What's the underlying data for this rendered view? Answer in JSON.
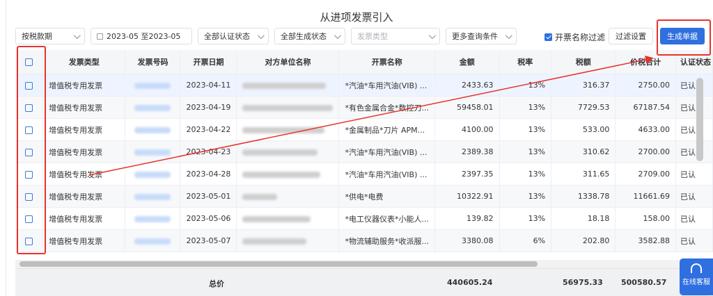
{
  "title": "从进项发票引入",
  "toolbar": {
    "period_type": "按税款期",
    "date_range": "2023-05  至2023-05",
    "auth_status": "全部认证状态",
    "gen_status": "全部生成状态",
    "invoice_type_placeholder": "发票类型",
    "more_filters": "更多查询条件",
    "name_filter_label": "开票名称过滤",
    "filter_settings": "过滤设置",
    "generate": "生成单据"
  },
  "table": {
    "headers": [
      "发票类型",
      "发票号码",
      "开票日期",
      "对方单位名称",
      "开票名称",
      "金额",
      "税率",
      "税额",
      "价税合计",
      "认证状态"
    ],
    "rows": [
      {
        "type": "增值税专用发票",
        "date": "2023-04-11",
        "item": "*汽油*车用汽油(VIB) ...",
        "amount": "2433.63",
        "rate": "13%",
        "tax": "316.37",
        "total": "2750.00",
        "auth": "已认"
      },
      {
        "type": "增值税专用发票",
        "date": "2023-04-19",
        "item": "*有色金属合金*数控刀...",
        "amount": "59458.01",
        "rate": "13%",
        "tax": "7729.53",
        "total": "67187.54",
        "auth": "已认"
      },
      {
        "type": "增值税专用发票",
        "date": "2023-04-22",
        "item": "*金属制品*刀片 APM...",
        "amount": "4100.00",
        "rate": "13%",
        "tax": "533.00",
        "total": "4633.00",
        "auth": "已认"
      },
      {
        "type": "增值税专用发票",
        "date": "2023-04-23",
        "item": "*汽油*车用汽油(VIB) ...",
        "amount": "2389.38",
        "rate": "13%",
        "tax": "310.62",
        "total": "2700.00",
        "auth": "已认"
      },
      {
        "type": "增值税专用发票",
        "date": "2023-04-28",
        "item": "*汽油*车用汽油(VIB) ...",
        "amount": "2397.35",
        "rate": "13%",
        "tax": "311.65",
        "total": "2709.00",
        "auth": "已认"
      },
      {
        "type": "增值税专用发票",
        "date": "2023-05-01",
        "item": "*供电*电费",
        "amount": "10322.91",
        "rate": "13%",
        "tax": "1338.78",
        "total": "11661.69",
        "auth": "已认"
      },
      {
        "type": "增值税专用发票",
        "date": "2023-05-06",
        "item": "*电工仪器仪表*小能人...",
        "amount": "139.82",
        "rate": "13%",
        "tax": "18.18",
        "total": "158.00",
        "auth": "已认"
      },
      {
        "type": "增值税专用发票",
        "date": "2023-05-07",
        "item": "*物流辅助服务*收派服...",
        "amount": "3380.08",
        "rate": "6%",
        "tax": "202.80",
        "total": "3582.88",
        "auth": "已认"
      }
    ]
  },
  "footer": {
    "label": "总价",
    "amount": "440605.24",
    "tax": "56975.33",
    "total": "500580.57"
  },
  "support": {
    "label": "在线客服"
  },
  "colors": {
    "primary": "#2f6fe0",
    "annotation": "#e8322b"
  }
}
